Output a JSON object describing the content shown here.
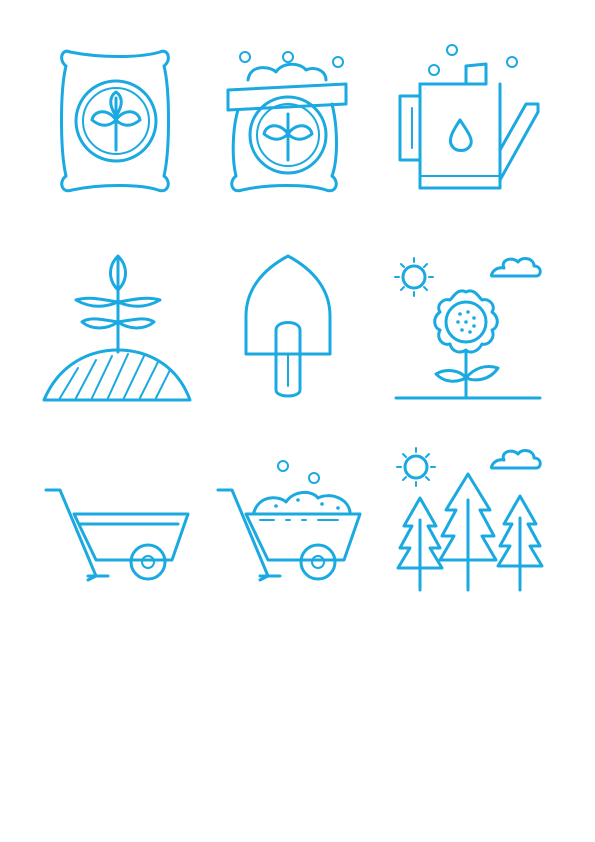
{
  "sheet": {
    "background": "#ffffff",
    "accent": "#1aa9e0"
  },
  "icons": [
    {
      "name": "seed-bag-icon"
    },
    {
      "name": "open-seed-bag-icon"
    },
    {
      "name": "watering-can-icon"
    },
    {
      "name": "sprout-mound-icon"
    },
    {
      "name": "shovel-icon"
    },
    {
      "name": "sunflower-icon"
    },
    {
      "name": "empty-wheelbarrow-icon"
    },
    {
      "name": "soil-wheelbarrow-icon"
    },
    {
      "name": "pine-forest-icon"
    }
  ]
}
